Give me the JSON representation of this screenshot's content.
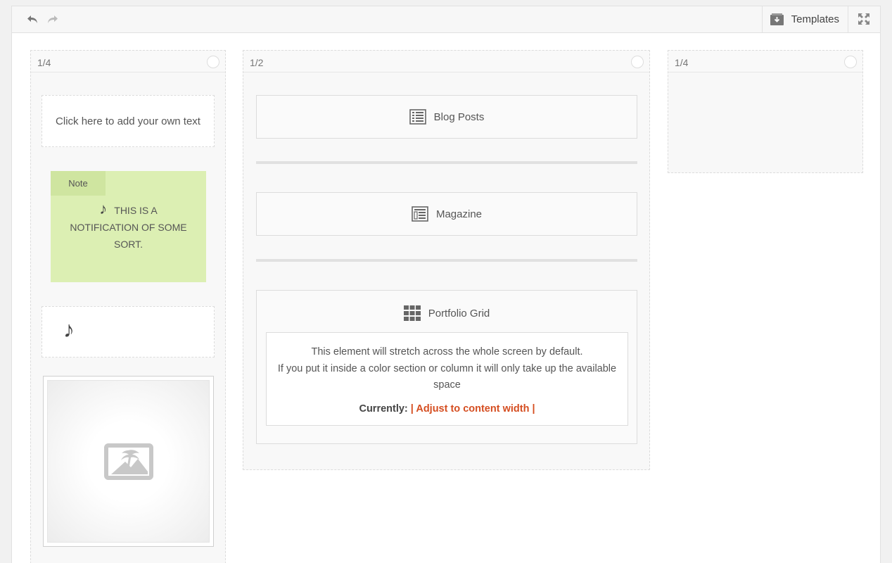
{
  "toolbar": {
    "undo_icon": "undo-icon",
    "redo_icon": "redo-icon",
    "templates_label": "Templates",
    "fullscreen_icon": "fullscreen-icon"
  },
  "columns": [
    {
      "size": "1/4"
    },
    {
      "size": "1/2"
    },
    {
      "size": "1/4"
    }
  ],
  "left_column": {
    "text_block": "Click here to add your own text",
    "note": {
      "tab": "Note",
      "icon": "music-note-icon",
      "text": "THIS IS A NOTIFICATION OF SOME SORT."
    },
    "icon_block": "music-note-icon",
    "image_block": "image-placeholder-icon"
  },
  "middle_column": {
    "blog_posts": "Blog Posts",
    "magazine": "Magazine",
    "portfolio": {
      "title": "Portfolio Grid",
      "notice_line1": "This element will stretch across the whole screen by default.",
      "notice_line2": "If you put it inside a color section or column it will only take up the available space",
      "current_label": "Currently:",
      "current_value": "| Adjust to content width |"
    }
  },
  "colors": {
    "accent": "#d54e21",
    "note_bg": "#dcefb3",
    "note_tab": "#cfe5a0"
  }
}
